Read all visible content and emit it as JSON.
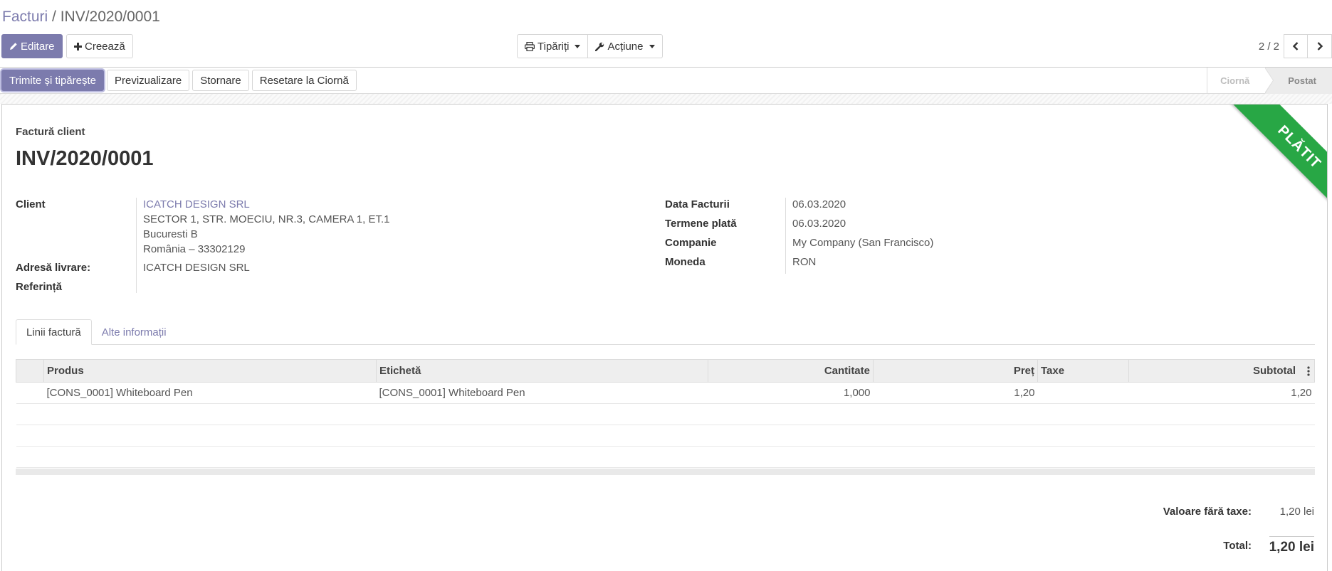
{
  "breadcrumb": {
    "parent": "Facturi",
    "separator": " / ",
    "current": "INV/2020/0001"
  },
  "toolbar": {
    "edit_label": "Editare",
    "create_label": "Creează",
    "print_label": "Tipăriți",
    "action_label": "Acțiune"
  },
  "pager": {
    "value": "2 / 2"
  },
  "statusbar": {
    "actions": [
      "Trimite și tipărește",
      "Previzualizare",
      "Stornare",
      "Resetare la Ciornă"
    ],
    "stages": [
      {
        "label": "Ciornă",
        "active": false
      },
      {
        "label": "Postat",
        "active": true
      }
    ]
  },
  "ribbon": {
    "label": "PLĂTIT",
    "color": "#28a745"
  },
  "invoice": {
    "type": "Factură client",
    "number": "INV/2020/0001",
    "client_label": "Client",
    "client_name": "ICATCH DESIGN SRL",
    "client_address_1": "SECTOR 1, STR. MOECIU, NR.3, CAMERA 1, ET.1",
    "client_address_2": "Bucuresti B",
    "client_address_3": "România – 33302129",
    "delivery_label": "Adresă livrare:",
    "delivery_value": "ICATCH DESIGN SRL",
    "reference_label": "Referință",
    "date_label": "Data Facturii",
    "date_value": "06.03.2020",
    "terms_label": "Termene plată",
    "terms_value": "06.03.2020",
    "company_label": "Companie",
    "company_value": "My Company (San Francisco)",
    "currency_label": "Moneda",
    "currency_value": "RON"
  },
  "tabs": [
    "Linii factură",
    "Alte informații"
  ],
  "table": {
    "headers": {
      "product": "Produs",
      "label": "Etichetă",
      "quantity": "Cantitate",
      "price": "Preț",
      "taxes": "Taxe",
      "subtotal": "Subtotal"
    },
    "rows": [
      {
        "product": "[CONS_0001] Whiteboard Pen",
        "label": "[CONS_0001] Whiteboard Pen",
        "quantity": "1,000",
        "price": "1,20",
        "taxes": "",
        "subtotal": "1,20"
      }
    ]
  },
  "totals": {
    "untaxed_label": "Valoare fără taxe:",
    "untaxed_value": "1,20 lei",
    "total_label": "Total:",
    "total_value": "1,20 lei"
  },
  "colors": {
    "primary": "#7c7bad",
    "paid": "#28a745"
  }
}
